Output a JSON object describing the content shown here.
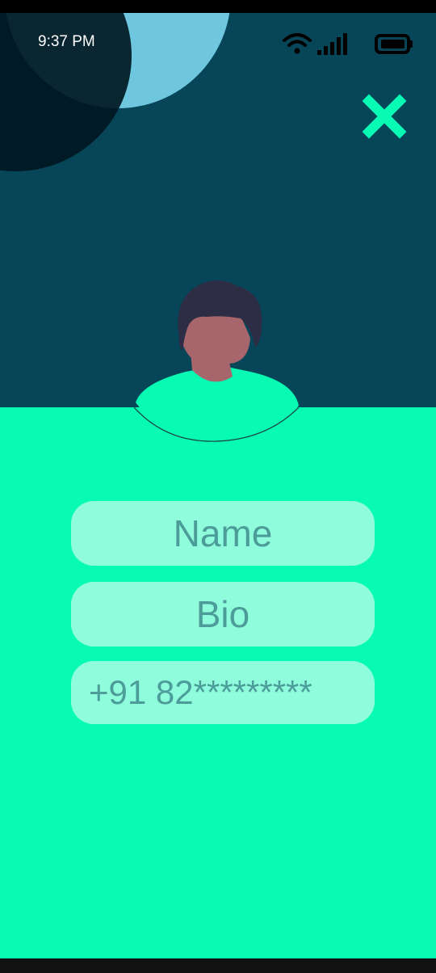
{
  "status_bar": {
    "time": "9:37 PM",
    "icons": [
      "wifi-icon",
      "signal-icon",
      "battery-icon"
    ]
  },
  "header": {
    "close_icon": "close-icon"
  },
  "form": {
    "name_placeholder": "Name",
    "bio_placeholder": "Bio",
    "phone_value": "+91 82*********"
  },
  "colors": {
    "header_bg": "#074559",
    "accent": "#08fbb3",
    "field_bg": "#8ffcdb",
    "field_text": "#4c9d9a",
    "skin": "#a7666b",
    "hair": "#2d2d45"
  }
}
